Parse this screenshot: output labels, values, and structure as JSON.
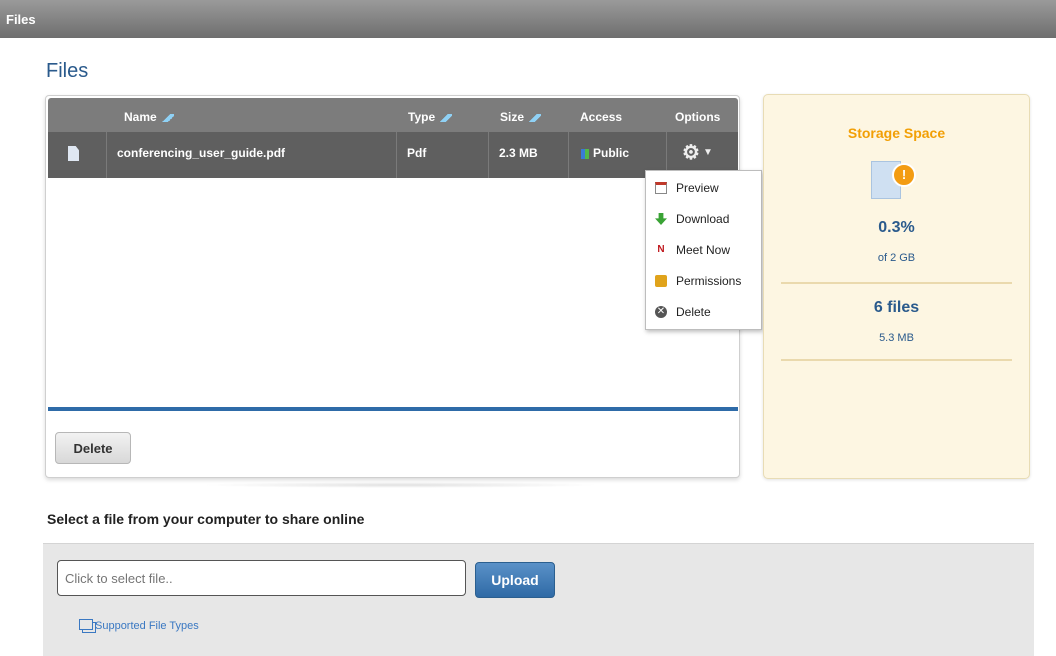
{
  "window": {
    "title": "Files"
  },
  "page": {
    "heading": "Files"
  },
  "table": {
    "columns": [
      "Name",
      "Type",
      "Size",
      "Access",
      "Options"
    ],
    "rows": [
      {
        "name": "conferencing_user_guide.pdf",
        "type": "Pdf",
        "size": "2.3 MB",
        "access": "Public"
      }
    ],
    "delete_label": "Delete"
  },
  "options_menu": {
    "items": [
      "Preview",
      "Download",
      "Meet Now",
      "Permissions",
      "Delete"
    ]
  },
  "storage": {
    "title": "Storage Space",
    "percent": "0.3%",
    "quota": "of 2 GB",
    "file_count": "6 files",
    "total_size": "5.3 MB"
  },
  "upload": {
    "heading": "Select a file from your computer to share online",
    "placeholder": "Click to select file..",
    "button_label": "Upload",
    "supported_link": "Supported File Types"
  },
  "colors": {
    "accent": "#2a5a8c",
    "storage_title": "#f29f05",
    "upload_button": "#3a78c2"
  }
}
